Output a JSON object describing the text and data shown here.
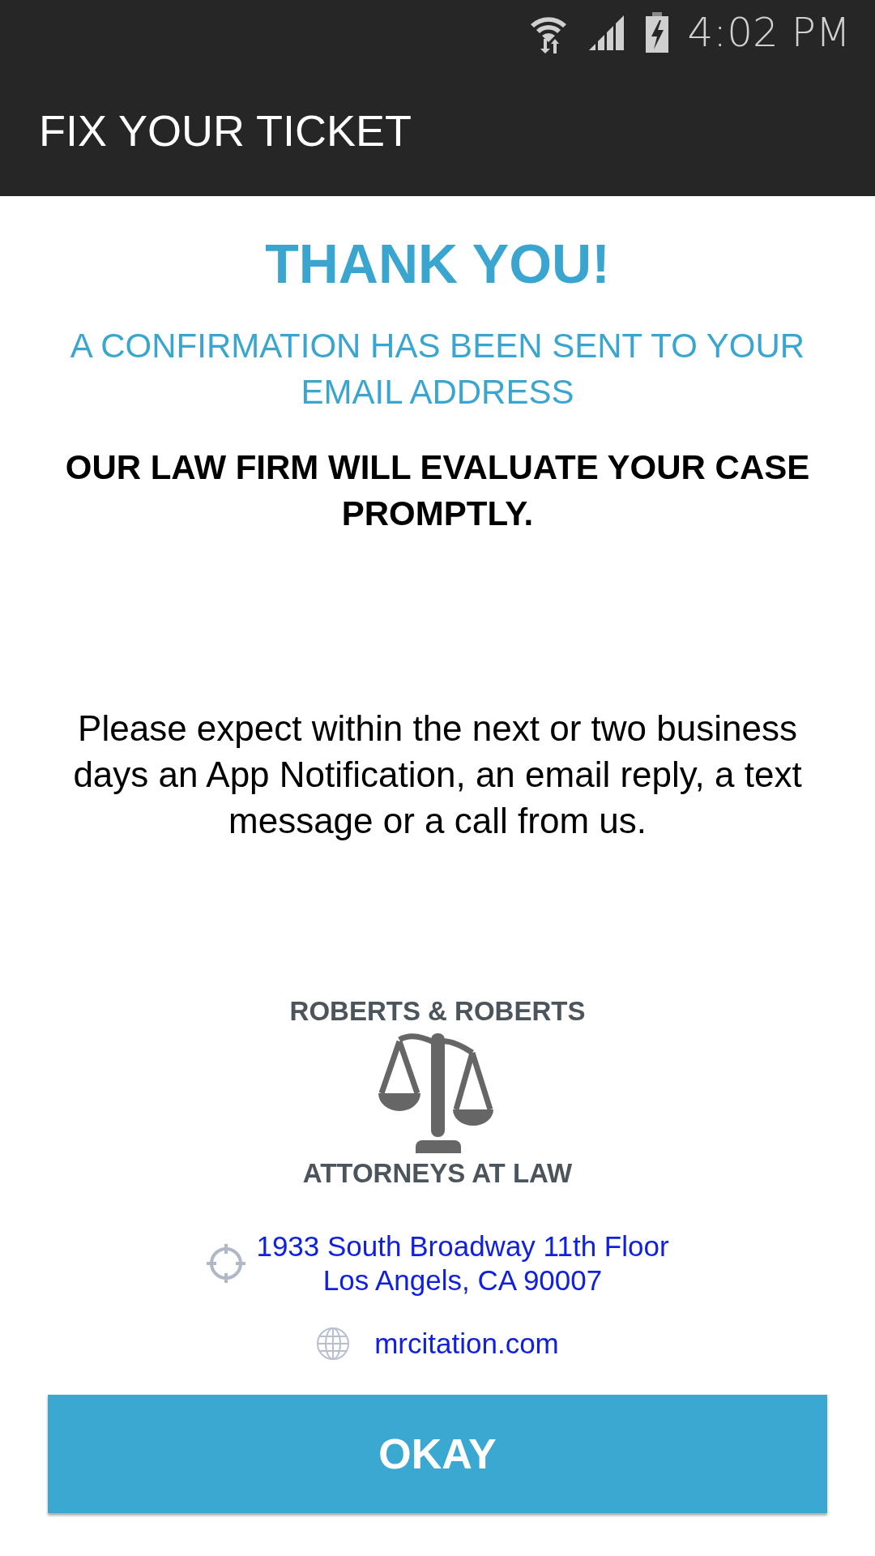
{
  "status_bar": {
    "time": "4:02 PM"
  },
  "app_bar": {
    "title": "FIX YOUR TICKET"
  },
  "heading": "THANK YOU!",
  "confirmation": "A CONFIRMATION HAS BEEN SENT TO YOUR EMAIL ADDRESS",
  "notice": "OUR LAW FIRM WILL EVALUATE YOUR CASE PROMPTLY.",
  "message": "Please expect within the next or two business days an App Notification, an email reply, a text message or a call from us.",
  "firm": {
    "name": "ROBERTS & ROBERTS",
    "tagline": "ATTORNEYS AT LAW"
  },
  "contacts": [
    {
      "kind": "address",
      "lines": [
        "1933 South Broadway 11th Floor",
        "Los Angels, CA 90007"
      ]
    },
    {
      "kind": "website",
      "lines": [
        "mrcitation.com"
      ]
    }
  ],
  "button": "OKAY"
}
